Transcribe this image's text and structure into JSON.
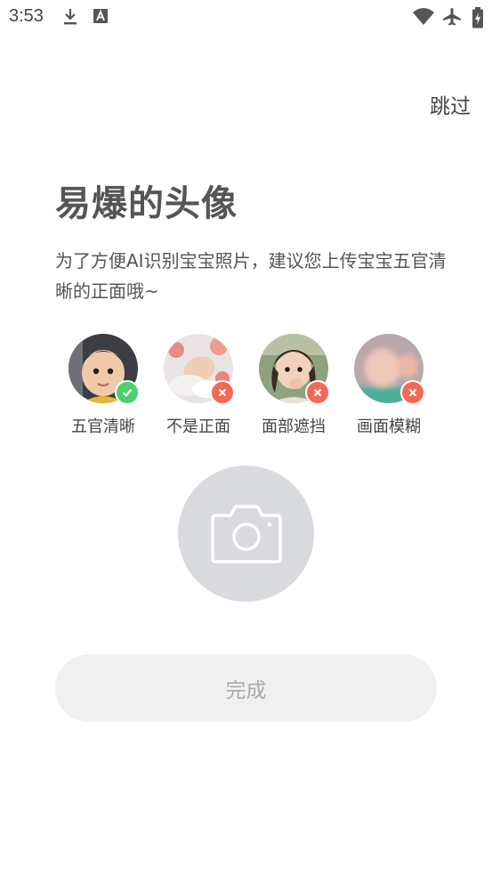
{
  "status_bar": {
    "time": "3:53",
    "icons": [
      "download-icon",
      "font-icon",
      "wifi-icon",
      "airplane-icon",
      "battery-icon"
    ]
  },
  "header": {
    "skip_label": "跳过"
  },
  "main": {
    "title": "易爆的头像",
    "description": "为了方便AI识别宝宝照片，建议您上传宝宝五官清晰的正面哦~",
    "examples": [
      {
        "label": "五官清晰",
        "status": "ok"
      },
      {
        "label": "不是正面",
        "status": "bad"
      },
      {
        "label": "面部遮挡",
        "status": "bad"
      },
      {
        "label": "画面模糊",
        "status": "bad"
      }
    ],
    "done_label": "完成"
  },
  "colors": {
    "ok_badge": "#4ccf6e",
    "bad_badge": "#f26a56",
    "camera_bg": "#d8dadd",
    "done_bg": "#f0f0f0",
    "done_text": "#aaaaaa"
  }
}
